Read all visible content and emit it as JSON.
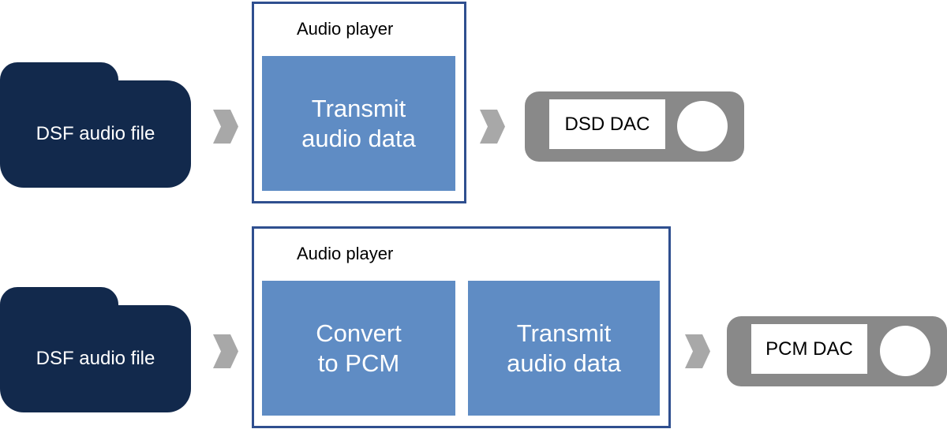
{
  "colors": {
    "file": "#12294c",
    "player_border": "#2f4f8f",
    "step": "#5f8cc4",
    "dac": "#898989",
    "arrow": "#a8a8a8"
  },
  "rows": [
    {
      "file_label": "DSF audio file",
      "player_label": "Audio player",
      "steps": [
        "Transmit\naudio data"
      ],
      "dac_label": "DSD DAC"
    },
    {
      "file_label": "DSF audio file",
      "player_label": "Audio player",
      "steps": [
        "Convert\nto PCM",
        "Transmit\naudio data"
      ],
      "dac_label": "PCM DAC"
    }
  ]
}
